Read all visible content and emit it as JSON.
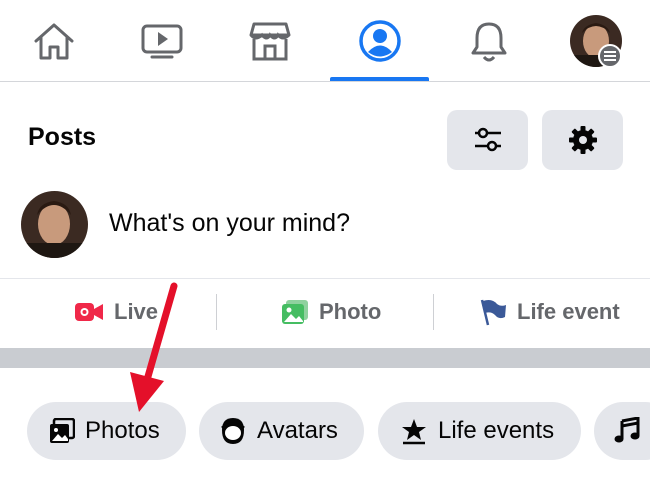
{
  "nav": {
    "tabs": [
      {
        "icon": "home-icon"
      },
      {
        "icon": "video-icon"
      },
      {
        "icon": "marketplace-icon"
      },
      {
        "icon": "profile-icon",
        "active": true
      },
      {
        "icon": "bell-icon"
      },
      {
        "icon": "account-avatar"
      }
    ],
    "accent": "#1877f2"
  },
  "posts": {
    "title": "Posts",
    "filter_icon": "filter-icon",
    "settings_icon": "gear-icon"
  },
  "composer": {
    "prompt": "What's on your mind?"
  },
  "actions": [
    {
      "label": "Live",
      "icon": "live-video-icon",
      "color": "#f02849"
    },
    {
      "label": "Photo",
      "icon": "photo-icon",
      "color": "#45bd62"
    },
    {
      "label": "Life event",
      "icon": "flag-icon",
      "color": "#3b5998"
    }
  ],
  "chips": [
    {
      "label": "Photos",
      "icon": "photos-icon"
    },
    {
      "label": "Avatars",
      "icon": "avatar-icon"
    },
    {
      "label": "Life events",
      "icon": "life-events-icon"
    },
    {
      "label": "",
      "icon": "music-icon"
    }
  ],
  "annotation": {
    "arrow_color": "#e4102a"
  }
}
